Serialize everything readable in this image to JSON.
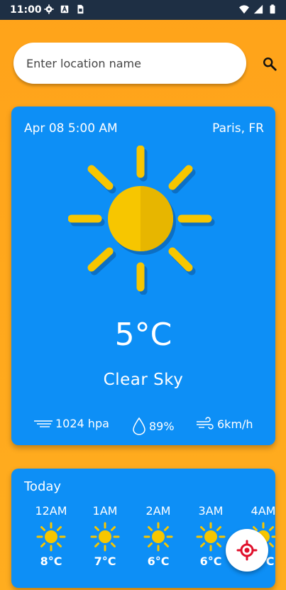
{
  "status_bar": {
    "time": "11:00",
    "left_icons": [
      "gear-icon",
      "a-badge-icon",
      "sim-card-icon"
    ],
    "right_icons": [
      "wifi-icon",
      "signal-icon",
      "battery-icon"
    ]
  },
  "search": {
    "placeholder": "Enter location name",
    "value": ""
  },
  "current": {
    "datetime": "Apr 08 5:00 AM",
    "location": "Paris, FR",
    "temperature": "5°C",
    "condition": "Clear Sky",
    "pressure": "1024 hpa",
    "humidity": "89%",
    "wind": "6km/h",
    "icon": "sun-icon"
  },
  "today": {
    "title": "Today",
    "hours": [
      {
        "time": "12AM",
        "temp": "8°C",
        "icon": "sun-icon"
      },
      {
        "time": "1AM",
        "temp": "7°C",
        "icon": "sun-icon"
      },
      {
        "time": "2AM",
        "temp": "6°C",
        "icon": "sun-icon"
      },
      {
        "time": "3AM",
        "temp": "6°C",
        "icon": "sun-icon"
      },
      {
        "time": "4AM",
        "temp": "5°C",
        "icon": "sun-icon"
      }
    ]
  },
  "colors": {
    "background": "#ffa31a",
    "card": "#0d8ff6",
    "sun": "#f7c600",
    "status_bar": "#1e2f44",
    "fab_icon": "#e0102b"
  }
}
